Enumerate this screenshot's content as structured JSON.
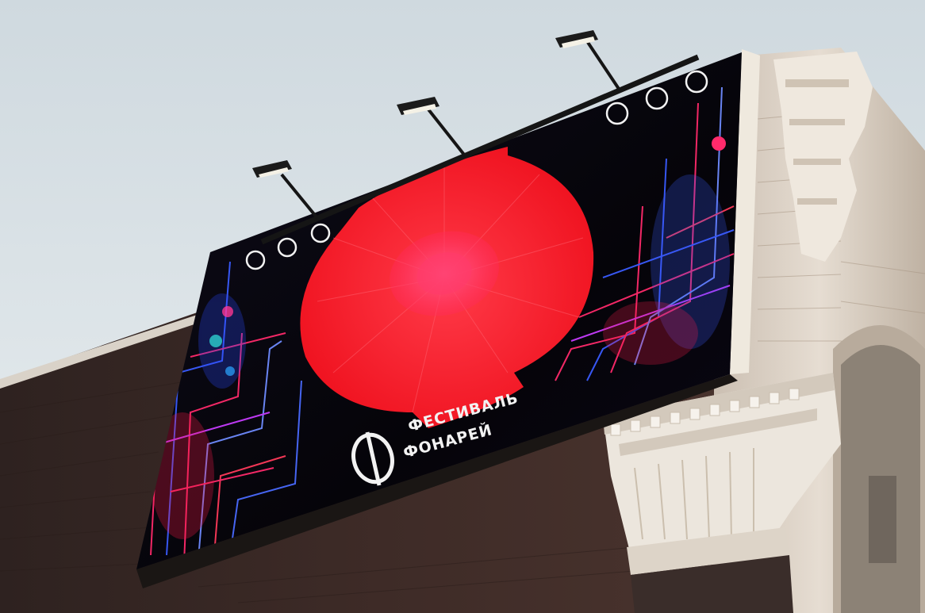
{
  "billboard": {
    "title_line1": "ФЕСТИВАЛЬ",
    "title_line2": "ФОНАРЕЙ",
    "colors": {
      "sky": "#dfe6ea",
      "brick": "#3b2a26",
      "stone": "#e8e1d6",
      "screen_bg": "#0b0a14",
      "lantern_red": "#ff1f2e",
      "neon_blue": "#3a5cff",
      "neon_pink": "#ff2a6b"
    }
  },
  "scene_icons": [
    "logo-emblem-icon",
    "spotlight-icon"
  ]
}
